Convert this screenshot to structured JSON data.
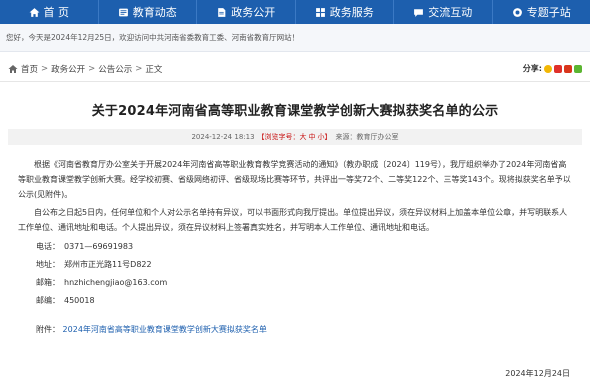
{
  "nav": {
    "items": [
      {
        "label": "首 页",
        "icon": "home-icon"
      },
      {
        "label": "教育动态",
        "icon": "news-icon"
      },
      {
        "label": "政务公开",
        "icon": "document-icon"
      },
      {
        "label": "政务服务",
        "icon": "service-icon"
      },
      {
        "label": "交流互动",
        "icon": "chat-icon"
      },
      {
        "label": "专题子站",
        "icon": "topic-icon"
      }
    ]
  },
  "welcome": {
    "text": "您好，今天是2024年12月25日，欢迎访问中共河南省委教育工委、河南省教育厅网站！"
  },
  "breadcrumb": {
    "items": [
      "首页",
      "政务公开",
      "公告公示",
      "正文"
    ]
  },
  "share": {
    "label": "分享:"
  },
  "article": {
    "title": "关于2024年河南省高等职业教育课堂教学创新大赛拟获奖名单的公示",
    "meta_date": "2024-12-24 18:13",
    "meta_views_prefix": "【浏览字号：",
    "meta_size_big": "大",
    "meta_size_mid": "中",
    "meta_size_small": "小",
    "meta_views_suffix": "】",
    "meta_source": "来源：教育厅办公室",
    "para1": "根据《河南省教育厅办公室关于开展2024年河南省高等职业教育教学竞赛活动的通知》（教办职成〔2024〕119号），我厅组织举办了2024年河南省高等职业教育课堂教学创新大赛。经学校初赛、省级网络初评、省级现场比赛等环节，共评出一等奖72个、二等奖122个、三等奖143个。现将拟获奖名单予以公示(见附件)。",
    "para2": "自公布之日起5日内，任何单位和个人对公示名单持有异议，可以书面形式向我厅提出。单位提出异议，须在异议材料上加盖本单位公章，并写明联系人工作单位、通讯地址和电话。个人提出异议，须在异议材料上签署真实姓名，并写明本人工作单位、通讯地址和电话。",
    "phone_label": "电话：",
    "phone": "0371—69691983",
    "address_label": "地址：",
    "address": "郑州市正光路11号D822",
    "email_label": "邮箱：",
    "email": "hnzhichengjiao@163.com",
    "postcode_label": "邮编：",
    "postcode": "450018",
    "attachment_label": "附件：",
    "attachment": "2024年河南省高等职业教育课堂教学创新大赛拟获奖名单",
    "sign_date": "2024年12月24日"
  }
}
